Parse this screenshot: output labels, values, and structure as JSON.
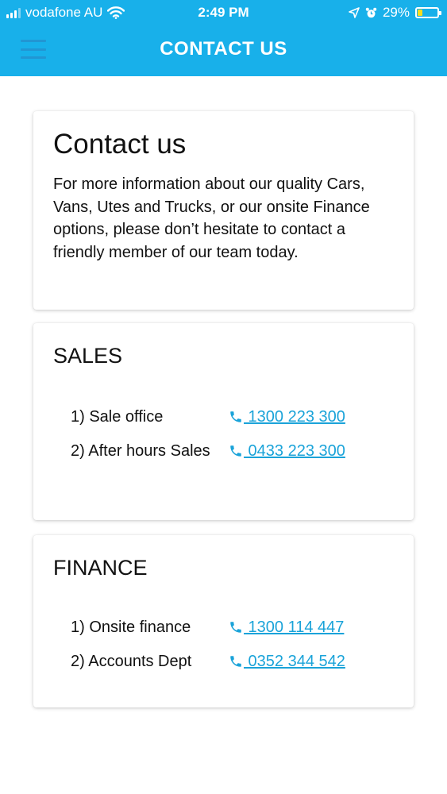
{
  "status_bar": {
    "carrier": "vodafone AU",
    "time": "2:49 PM",
    "battery": "29%",
    "battery_fill_percent": 29,
    "battery_color": "#f7dd1d"
  },
  "header": {
    "title": "CONTACT US",
    "background_color": "#18b0ea",
    "menu_icon": "hamburger-menu-icon"
  },
  "intro": {
    "heading": "Contact us",
    "text": "For more information about our quality Cars, Vans, Utes and Trucks, or our onsite Finance options, please don’t hesitate to contact a friendly member of our team today."
  },
  "sales": {
    "title": "SALES",
    "items": [
      {
        "label": "1) Sale office",
        "phone": " 1300 223 300"
      },
      {
        "label": "2) After hours Sales",
        "phone": " 0433 223 300"
      }
    ]
  },
  "finance": {
    "title": "FINANCE",
    "items": [
      {
        "label": "1) Onsite finance",
        "phone": " 1300 114 447"
      },
      {
        "label": "2) Accounts Dept",
        "phone": " 0352 344 542"
      }
    ]
  },
  "link_color": "#1aa3d9",
  "phone_icon": "phone-icon"
}
